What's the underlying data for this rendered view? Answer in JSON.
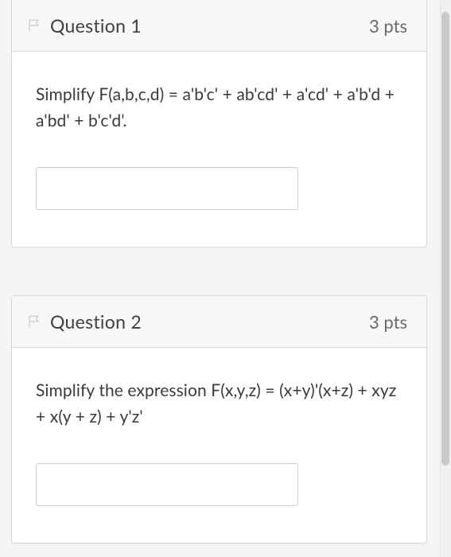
{
  "questions": [
    {
      "title": "Question 1",
      "points": "3 pts",
      "prompt": "Simplify F(a,b,c,d) = a'b'c' + ab'cd' + a'cd' + a'b'd + a'bd' + b'c'd'.",
      "answer_value": ""
    },
    {
      "title": "Question 2",
      "points": "3 pts",
      "prompt": "Simplify the expression F(x,y,z) = (x+y)'(x+z) + xyz + x(y + z) + y'z'",
      "answer_value": ""
    }
  ]
}
